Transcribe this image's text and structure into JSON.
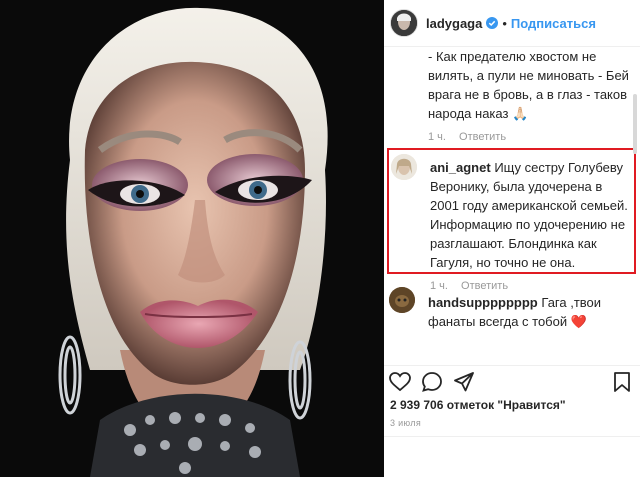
{
  "header": {
    "username": "ladygaga",
    "follow_label": "Подписаться",
    "separator": "•"
  },
  "comments": [
    {
      "username": "",
      "text": "- Как предателю хвостом не вилять, а пули не миновать - Бей врага не в бровь, а в глаз - таков народа наказ 🙏🏻",
      "time": "1 ч.",
      "reply_label": "Ответить"
    },
    {
      "username": "ani_agnet",
      "text": "Ищу сестру Голубеву Веронику, была удочерена в 2001 году американской семьей. Информацию по удочерению не разглашают. Блондинка как Гагуля, но точно не она.",
      "time": "1 ч.",
      "reply_label": "Ответить"
    },
    {
      "username": "handsupppppppp",
      "text": "Гага ,твои фанаты всегда с тобой",
      "heart": "❤️"
    }
  ],
  "footer": {
    "likes": "2 939 706 отметок \"Нравится\"",
    "date": "3 июля"
  },
  "colors": {
    "accent": "#3897f0",
    "highlight_border": "#e01b22"
  }
}
